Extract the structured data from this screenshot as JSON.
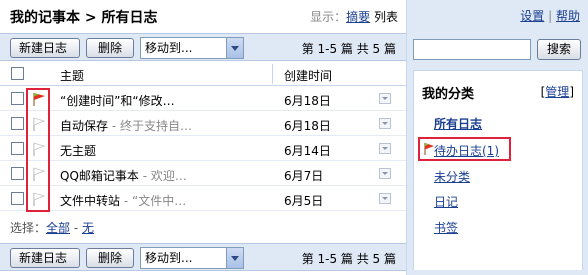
{
  "header": {
    "title": "我的记事本 > 所有日志",
    "display_label": "显示：",
    "view_summary": "摘要",
    "view_list": "列表"
  },
  "toolbar": {
    "new_label": "新建日志",
    "delete_label": "删除",
    "move_label": "移动到...",
    "pager_text": "第 1-5 篇 共 5 篇"
  },
  "table": {
    "columns": [
      "主题",
      "创建时间"
    ],
    "rows": [
      {
        "subject": "“创建时间”和“修改…",
        "preview": "",
        "date": "6月18日",
        "flag": "red"
      },
      {
        "subject": "自动保存",
        "preview": " - 终于支持自…",
        "date": "6月18日",
        "flag": "white"
      },
      {
        "subject": "无主题",
        "preview": "",
        "date": "6月14日",
        "flag": "white"
      },
      {
        "subject": "QQ邮箱记事本",
        "preview": " - 欢迎…",
        "date": "6月7日",
        "flag": "white"
      },
      {
        "subject": "文件中转站",
        "preview": " - “文件中…",
        "date": "6月5日",
        "flag": "white"
      }
    ]
  },
  "select": {
    "label": "选择：",
    "all": "全部",
    "sep": " - ",
    "none": "无"
  },
  "sidebar": {
    "settings": "设置",
    "sep": " | ",
    "help": "帮助",
    "search_button": "搜索",
    "search_placeholder": "",
    "categories_title": "我的分类",
    "manage_open": "[",
    "manage": "管理",
    "manage_close": "]",
    "categories": [
      "所有日志",
      "待办日志(1)",
      "未分类",
      "日记",
      "书签"
    ]
  },
  "colors": {
    "accent_blue": "#1b3f91",
    "panel_bg": "#dfe9f6",
    "highlight_red": "#e0213b",
    "flag_red": "#e03020"
  }
}
